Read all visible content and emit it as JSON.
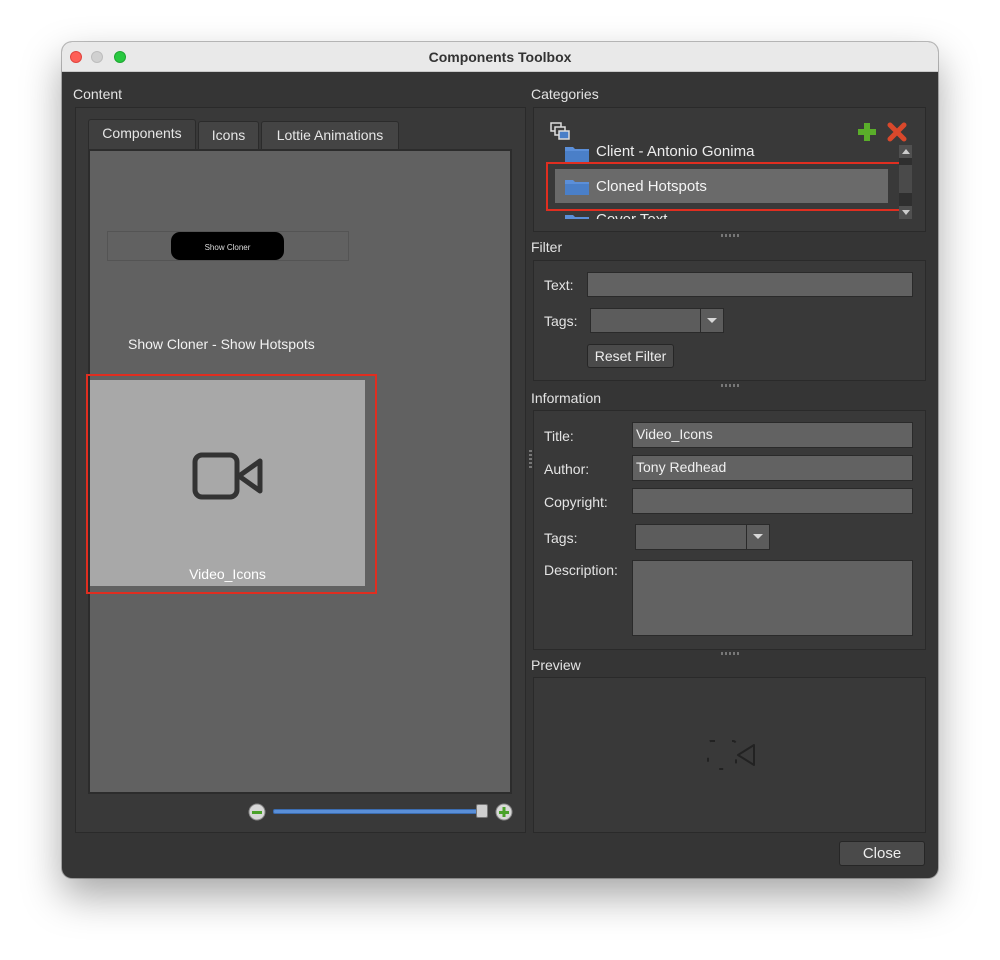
{
  "window": {
    "title": "Components Toolbox",
    "traffic_lights": [
      "#fe5f57",
      "#febc2e",
      "#28c840"
    ]
  },
  "content": {
    "section_label": "Content",
    "tabs": [
      {
        "label": "Components",
        "active": true
      },
      {
        "label": "Icons",
        "active": false
      },
      {
        "label": "Lottie Animations",
        "active": false
      }
    ],
    "items": [
      {
        "preview_button_label": "Show Cloner",
        "name": "Show Cloner - Show Hotspots"
      },
      {
        "name": "Video_Icons",
        "selected": true,
        "icon": "video-camera-icon"
      }
    ],
    "zoom": {
      "min_icon": "zoom-out-icon",
      "max_icon": "zoom-in-icon",
      "value": 1.0
    }
  },
  "categories": {
    "section_label": "Categories",
    "toolbar_icons": [
      "categories-tree-icon",
      "add-category-icon",
      "delete-category-icon"
    ],
    "items": [
      {
        "label": "Client - Antonio Gonima",
        "icon": "folder-icon"
      },
      {
        "label": "Cloned Hotspots",
        "icon": "folder-icon",
        "selected": true
      },
      {
        "label": "Cover Text",
        "icon": "folder-icon"
      }
    ]
  },
  "filter": {
    "section_label": "Filter",
    "text_label": "Text:",
    "text_value": "",
    "tags_label": "Tags:",
    "tags_value": "",
    "reset_label": "Reset Filter"
  },
  "information": {
    "section_label": "Information",
    "title_label": "Title:",
    "title_value": "Video_Icons",
    "author_label": "Author:",
    "author_value": "Tony Redhead",
    "copyright_label": "Copyright:",
    "copyright_value": "",
    "tags_label": "Tags:",
    "tags_value": "",
    "description_label": "Description:",
    "description_value": ""
  },
  "preview": {
    "section_label": "Preview",
    "icon": "video-camera-icon"
  },
  "footer": {
    "close_label": "Close"
  },
  "colors": {
    "window_bg": "#353535",
    "selection_outline": "#e02e20",
    "folder": "#5b8fd9",
    "add": "#5aae2a",
    "delete": "#d9482b"
  }
}
